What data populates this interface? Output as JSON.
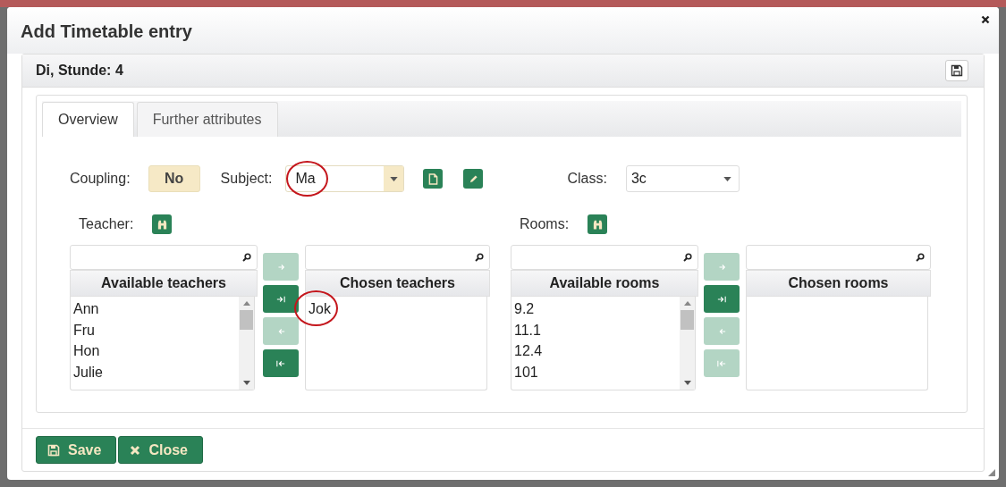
{
  "dialog": {
    "title": "Add Timetable entry"
  },
  "panel": {
    "title": "Di, Stunde: 4"
  },
  "tabs": [
    {
      "label": "Overview",
      "selected": true
    },
    {
      "label": "Further attributes",
      "selected": false
    }
  ],
  "coupling": {
    "label": "Coupling:",
    "value": "No"
  },
  "subject": {
    "label": "Subject:",
    "value": "Ma",
    "highlighted": true
  },
  "class": {
    "label": "Class:",
    "value": "3c"
  },
  "pickers": [
    {
      "label": "Teacher:",
      "available": {
        "title": "Available teachers",
        "items": [
          "Ann",
          "Fru",
          "Hon",
          "Julie"
        ]
      },
      "chosen": {
        "title": "Chosen teachers",
        "items": [
          {
            "label": "Jok",
            "highlighted": true
          }
        ]
      },
      "moves": [
        {
          "kind": "move",
          "disabled": true
        },
        {
          "kind": "move-all",
          "disabled": false
        },
        {
          "kind": "remove",
          "disabled": true
        },
        {
          "kind": "remove-all",
          "disabled": false
        }
      ]
    },
    {
      "label": "Rooms:",
      "available": {
        "title": "Available rooms",
        "items": [
          "9.2",
          "11.1",
          "12.4",
          "101"
        ]
      },
      "chosen": {
        "title": "Chosen rooms"
      },
      "moves": [
        {
          "kind": "move",
          "disabled": true
        },
        {
          "kind": "move-all",
          "disabled": false
        },
        {
          "kind": "remove",
          "disabled": true
        },
        {
          "kind": "remove-all",
          "disabled": true
        }
      ]
    }
  ],
  "buttons": [
    {
      "kind": "save",
      "label": "Save"
    },
    {
      "kind": "close",
      "label": "Close"
    }
  ]
}
